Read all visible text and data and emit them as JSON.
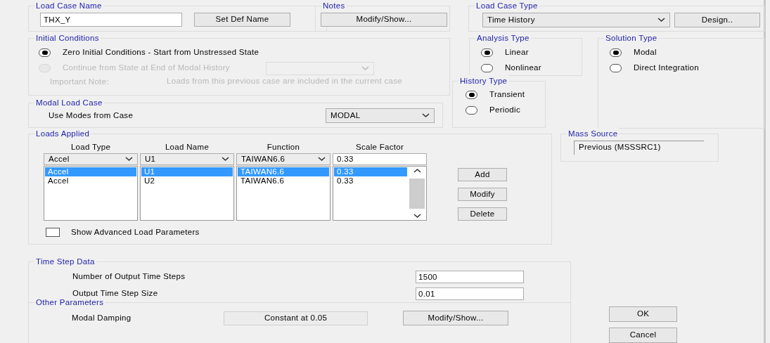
{
  "load_case_name": {
    "title": "Load Case Name",
    "value": "THX_Y",
    "button": "Set Def Name"
  },
  "notes": {
    "title": "Notes",
    "button": "Modify/Show..."
  },
  "load_case_type": {
    "title": "Load Case Type",
    "value": "Time History",
    "button": "Design.."
  },
  "initial_conditions": {
    "title": "Initial Conditions",
    "options": [
      {
        "label": "Zero Initial Conditions - Start from Unstressed State",
        "selected": true,
        "disabled": false
      },
      {
        "label": "Continue from State at End of Modal History",
        "selected": false,
        "disabled": true
      }
    ],
    "note_label": "Important Note:",
    "note_text": "Loads from this previous case are included in the current case"
  },
  "analysis_type": {
    "title": "Analysis Type",
    "options": [
      {
        "label": "Linear",
        "selected": true
      },
      {
        "label": "Nonlinear",
        "selected": false
      }
    ]
  },
  "solution_type": {
    "title": "Solution Type",
    "options": [
      {
        "label": "Modal",
        "selected": true
      },
      {
        "label": "Direct Integration",
        "selected": false
      }
    ]
  },
  "history_type": {
    "title": "History Type",
    "options": [
      {
        "label": "Transient",
        "selected": true
      },
      {
        "label": "Periodic",
        "selected": false
      }
    ]
  },
  "modal_load_case": {
    "title": "Modal Load Case",
    "label": "Use Modes from Case",
    "value": "MODAL"
  },
  "mass_source": {
    "title": "Mass Source",
    "value": "Previous  (MSSSRC1)"
  },
  "loads_applied": {
    "title": "Loads Applied",
    "columns": [
      "Load Type",
      "Load Name",
      "Function",
      "Scale Factor"
    ],
    "editor": [
      "Accel",
      "U1",
      "TAIWAN6.6",
      "0.33"
    ],
    "rows": [
      {
        "cells": [
          "Accel",
          "U1",
          "TAIWAN6.6",
          "0.33"
        ],
        "selected": true
      },
      {
        "cells": [
          "Accel",
          "U2",
          "TAIWAN6.6",
          "0.33"
        ],
        "selected": false
      }
    ],
    "buttons": [
      "Add",
      "Modify",
      "Delete"
    ],
    "advanced": {
      "label": "Show Advanced Load Parameters",
      "checked": false
    }
  },
  "time_step_data": {
    "title": "Time Step Data",
    "fields": [
      {
        "label": "Number of Output Time Steps",
        "value": "1500"
      },
      {
        "label": "Output Time Step Size",
        "value": "0.01"
      }
    ]
  },
  "other_parameters": {
    "title": "Other Parameters",
    "label": "Modal Damping",
    "value": "Constant at 0.05",
    "button": "Modify/Show..."
  },
  "buttons": [
    "OK",
    "Cancel"
  ]
}
